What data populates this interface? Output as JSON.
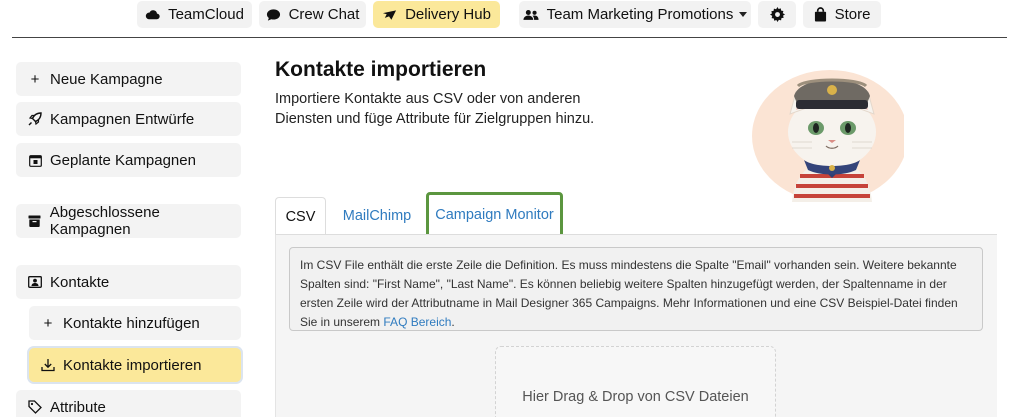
{
  "topnav": {
    "items": [
      {
        "label": "TeamCloud",
        "icon": "cloud-icon"
      },
      {
        "label": "Crew Chat",
        "icon": "chat-bubble-icon"
      },
      {
        "label": "Delivery Hub",
        "icon": "paper-plane-icon",
        "active": true
      },
      {
        "label": "Team Marketing Promotions",
        "icon": "users-icon",
        "dropdown": true
      },
      {
        "label": "",
        "icon": "gear-icon"
      },
      {
        "label": "Store",
        "icon": "shopping-bag-icon"
      }
    ]
  },
  "sidebar": {
    "items": [
      {
        "label": "Neue Kampagne",
        "icon": "plus-icon"
      },
      {
        "label": "Kampagnen Entwürfe",
        "icon": "rocket-icon"
      },
      {
        "label": "Geplante Kampagnen",
        "icon": "calendar-icon"
      },
      {
        "label": "Abgeschlossene Kampagnen",
        "icon": "archive-icon"
      },
      {
        "label": "Kontakte",
        "icon": "contact-card-icon"
      },
      {
        "label": "Kontakte hinzufügen",
        "icon": "plus-icon"
      },
      {
        "label": "Kontakte importieren",
        "icon": "download-icon",
        "active": true
      },
      {
        "label": "Attribute",
        "icon": "tag-icon"
      }
    ]
  },
  "main": {
    "title": "Kontakte importieren",
    "subtitle": "Importiere Kontakte aus CSV oder von anderen Diensten und füge Attribute für Zielgruppen hinzu.",
    "tabs": [
      {
        "label": "CSV",
        "active": true
      },
      {
        "label": "MailChimp"
      },
      {
        "label": "Campaign Monitor",
        "highlighted": true
      }
    ],
    "info": {
      "text": "Im CSV File enthält die erste Zeile die Definition. Es muss mindestens die Spalte \"Email\" vorhanden sein. Weitere bekannte Spalten sind: \"First Name\", \"Last Name\". Es können beliebig weitere Spalten hinzugefügt werden, der Spaltenname in der ersten Zeile wird der Attributname in Mail Designer 365 Campaigns. Mehr Informationen und eine CSV Beispiel-Datei finden Sie in unserem",
      "link": "FAQ Bereich",
      "suffix": "."
    },
    "dropzone": "Hier Drag & Drop von CSV Dateien"
  },
  "colors": {
    "accent_active": "#fbe89a",
    "link": "#2f7bbf",
    "highlight_outline": "#5b963f"
  }
}
